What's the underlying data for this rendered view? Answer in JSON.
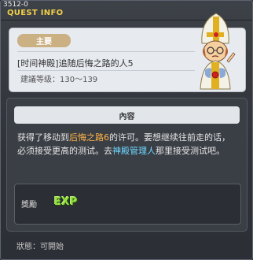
{
  "window": {
    "id_text": "3512-0",
    "title": "QUEST INFO"
  },
  "quest": {
    "badge": "主要",
    "title": "[时间神殿]追随后悔之路的人5",
    "level": "建議等级：130～139"
  },
  "content": {
    "header": "內容",
    "desc_part1": "获得了移动到",
    "desc_highlight1": "后悔之路6",
    "desc_part2": "的许可。要想继续往前走的话，必须接受更高的测试。去",
    "desc_highlight2": "神殿管理人",
    "desc_part3": "那里接受测试吧。"
  },
  "reward": {
    "label": "獎勵",
    "exp": "EXP"
  },
  "status": "狀態：可開始",
  "colors": {
    "title": "#f2cf49",
    "orange_highlight": "#ffb347",
    "cyan_highlight": "#6fd7ff",
    "exp": "#8ee23c"
  }
}
